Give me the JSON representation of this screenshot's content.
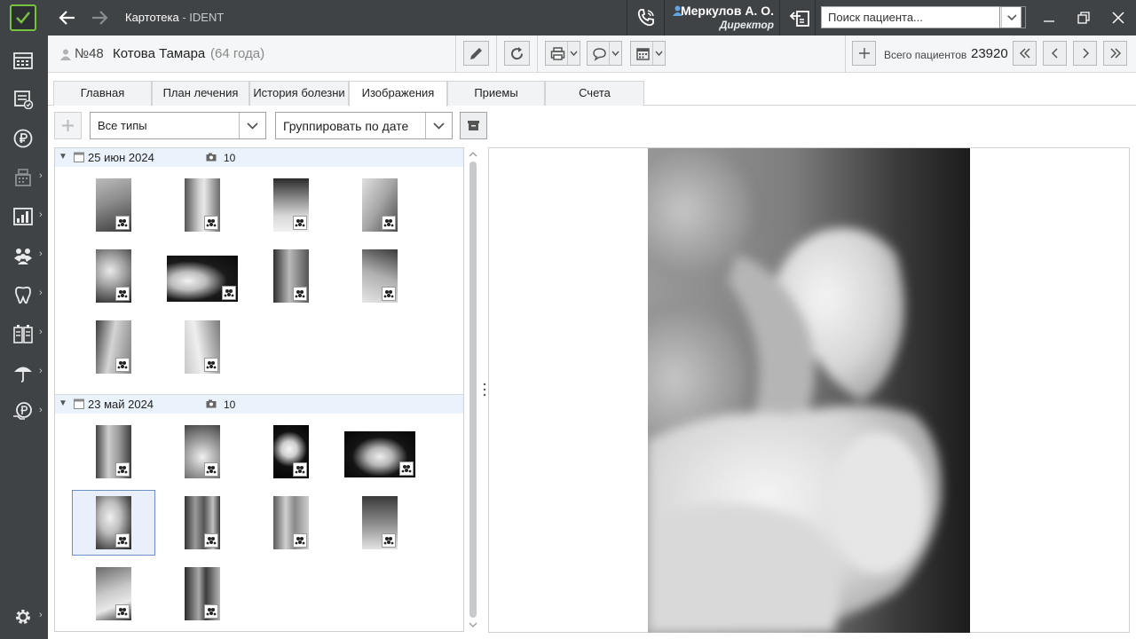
{
  "app": {
    "title": "Картотека",
    "title_suffix": " - IDENT"
  },
  "user": {
    "name": "Меркулов А. О.",
    "role": "Директор"
  },
  "search": {
    "placeholder": "Поиск пациента..."
  },
  "patient": {
    "number": "№48",
    "name": "Котова Тамара",
    "age": "(64 года)"
  },
  "totals": {
    "label": "Всего пациентов",
    "count": "23920"
  },
  "tabs": [
    {
      "label": "Главная"
    },
    {
      "label": "План лечения"
    },
    {
      "label": "История болезни"
    },
    {
      "label": "Изображения",
      "active": true
    },
    {
      "label": "Приемы"
    },
    {
      "label": "Счета"
    }
  ],
  "filters": {
    "type": "Все типы",
    "group": "Группировать по дате"
  },
  "groups": [
    {
      "date": "25 июн 2024",
      "count": "10"
    },
    {
      "date": "23 май 2024",
      "count": "10"
    }
  ],
  "sidebar": {
    "icons": [
      "schedule-icon",
      "tasks-icon",
      "ruble-icon",
      "cash-register-icon",
      "reports-icon",
      "patients-icon",
      "tooth-icon",
      "labs-icon",
      "insurance-icon",
      "payments-icon",
      "settings-icon"
    ]
  },
  "colors": {
    "sidebar": "#3f4346",
    "accent": "#7ac142",
    "group_header": "#eaf3fb",
    "selection": "#6b8fc9"
  }
}
